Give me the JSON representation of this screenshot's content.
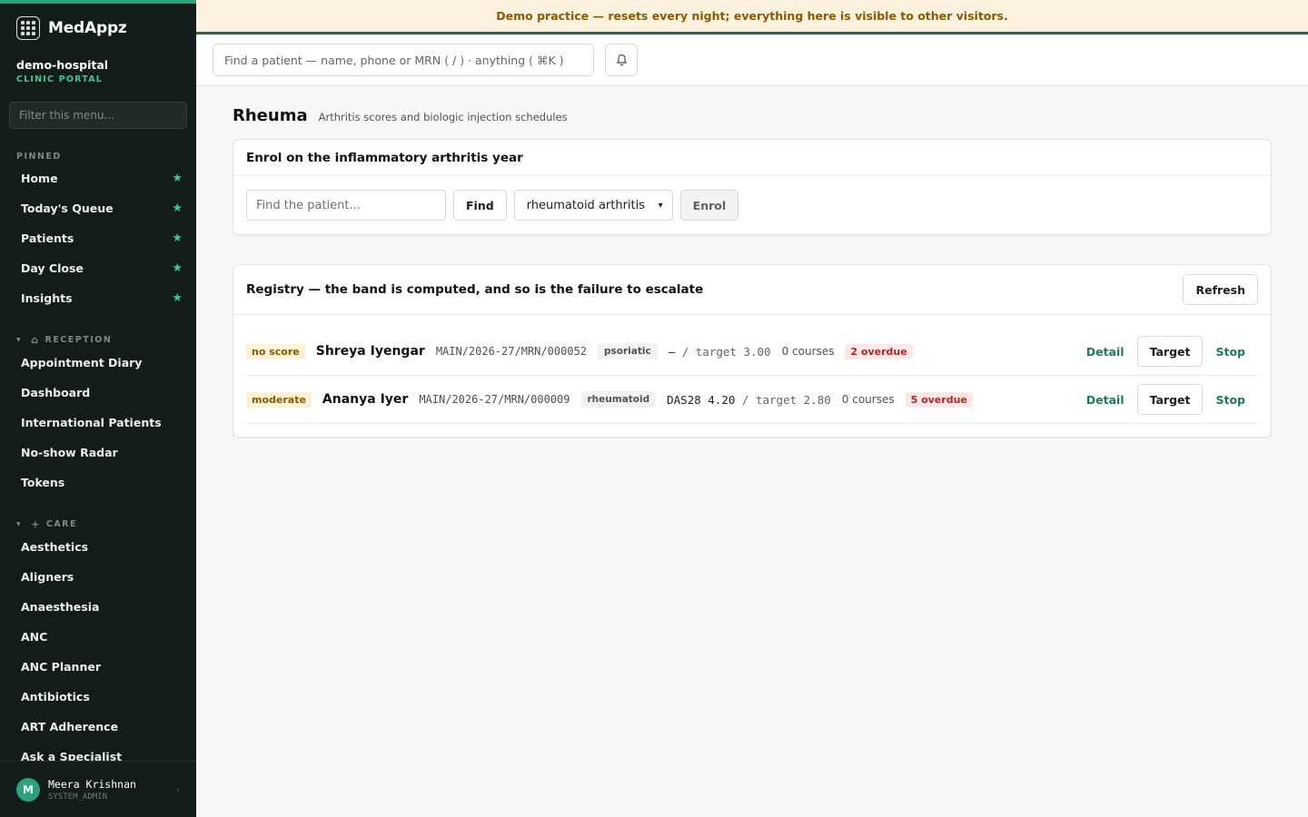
{
  "app": {
    "name": "MedAppz",
    "tenant": "demo-hospital",
    "tenant_sub": "CLINIC PORTAL"
  },
  "banner": "Demo practice — resets every night; everything here is visible to other visitors.",
  "sidebar": {
    "filter_placeholder": "Filter this menu...",
    "pinned_label": "PINNED",
    "pinned": [
      {
        "label": "Home"
      },
      {
        "label": "Today's Queue"
      },
      {
        "label": "Patients"
      },
      {
        "label": "Day Close"
      },
      {
        "label": "Insights"
      }
    ],
    "reception_label": "RECEPTION",
    "reception": [
      {
        "label": "Appointment Diary"
      },
      {
        "label": "Dashboard"
      },
      {
        "label": "International Patients"
      },
      {
        "label": "No-show Radar"
      },
      {
        "label": "Tokens"
      }
    ],
    "care_label": "CARE",
    "care": [
      {
        "label": "Aesthetics"
      },
      {
        "label": "Aligners"
      },
      {
        "label": "Anaesthesia"
      },
      {
        "label": "ANC"
      },
      {
        "label": "ANC Planner"
      },
      {
        "label": "Antibiotics"
      },
      {
        "label": "ART Adherence"
      },
      {
        "label": "Ask a Specialist"
      }
    ],
    "user": {
      "initial": "M",
      "name": "Meera Krishnan",
      "role": "SYSTEM_ADMIN"
    }
  },
  "topbar": {
    "search_placeholder": "Find a patient — name, phone or MRN ( / ) · anything ( ⌘K )"
  },
  "page": {
    "title": "Rheuma",
    "subtitle": "Arthritis scores and biologic injection schedules"
  },
  "enrol": {
    "title": "Enrol on the inflammatory arthritis year",
    "patient_placeholder": "Find the patient...",
    "find_label": "Find",
    "condition_selected": "rheumatoid arthritis",
    "enrol_label": "Enrol"
  },
  "registry": {
    "title": "Registry — the band is computed, and so is the failure to escalate",
    "refresh_label": "Refresh",
    "rows": [
      {
        "band": "no score",
        "name": "Shreya Iyengar",
        "mrn": "MAIN/2026-27/MRN/000052",
        "type": "psoriatic",
        "score": "—",
        "target": "/ target 3.00",
        "courses": "0 courses",
        "overdue": "2 overdue"
      },
      {
        "band": "moderate",
        "name": "Ananya Iyer",
        "mrn": "MAIN/2026-27/MRN/000009",
        "type": "rheumatoid",
        "score": "DAS28 4.20",
        "target": "/ target 2.80",
        "courses": "0 courses",
        "overdue": "5 overdue"
      }
    ],
    "actions": {
      "detail": "Detail",
      "target": "Target",
      "stop": "Stop"
    }
  },
  "colors": {
    "sidebar_bg": "#111c1b",
    "accent": "#2aa37f",
    "banner_bg": "#fbf1dc",
    "banner_text": "#8a5a00",
    "overdue_text": "#b3261e",
    "link": "#1f7a5c"
  }
}
